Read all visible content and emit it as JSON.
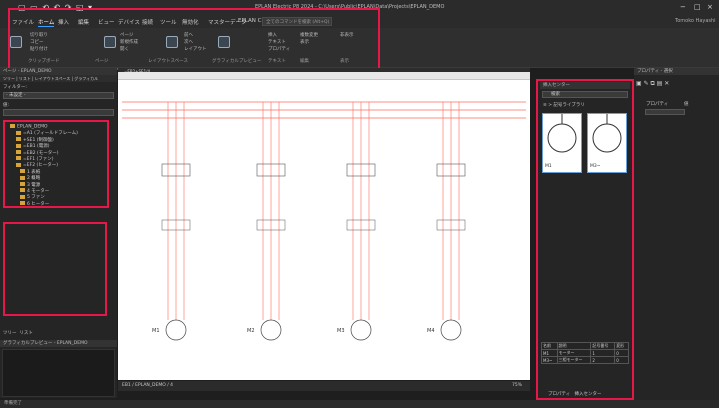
{
  "window": {
    "title": "EPLAN Electric P8 2024 - C:\\Users\\Public\\EPLAN\\Data\\Projects\\EPLAN_DEMO",
    "min": "−",
    "max": "□",
    "close": "×"
  },
  "menu": [
    "ファイル",
    "ホーム",
    "挿入",
    "編集",
    "ビュー",
    "デバイス",
    "接続",
    "ツール",
    "無効化",
    "マスターデータ",
    "EPLAN Cloud"
  ],
  "menu_active": 1,
  "search_placeholder": "全てのコマンドを検索 (Alt+Q)",
  "user": "Tomoko Hayashi",
  "ribbon": {
    "groups": [
      "クリップボード",
      "ページ",
      "レイアウトスペース",
      "グラフィカルプレビュー",
      "テキスト",
      "編集",
      "表示"
    ],
    "items": [
      "切り取り",
      "コピー",
      "貼り付け",
      "ページ",
      "新規作成",
      "開く",
      "前へ",
      "次へ",
      "レイアウト",
      "挿入",
      "テキスト",
      "プロパティ",
      "複数変更",
      "表示",
      "非表示"
    ]
  },
  "left_panel": {
    "title": "ページ - EPLAN_DEMO",
    "tabs": [
      "ツリー",
      "リスト",
      "レイアウトスペース",
      "グラフィカル"
    ],
    "filter_label": "フィルター:",
    "filter_value": "- 未設定 -",
    "value_label": "値:",
    "tree": [
      "EPLAN_DEMO",
      "=A1 (フィールドフレーム)",
      "+SE1 (制御盤)",
      "=EB1 (電源)",
      "=EB2 (モーター)",
      "=EF1 (ファン)",
      "=EF2 (ヒーター)",
      "1 表紙",
      "2 概略",
      "3 電源",
      "4 モーター",
      "5 ファン",
      "6 ヒーター"
    ],
    "bottom_tabs": [
      "ツリー",
      "リスト"
    ],
    "preview_title": "グラフィカルプレビュー - EPLAN_DEMO"
  },
  "doc_tab": "=EB2+SE1/4",
  "motors": [
    "M1",
    "M2",
    "M3",
    "M4"
  ],
  "right_panel": {
    "title": "挿入センター",
    "search_placeholder": "検索",
    "crumb": "≡ > 記号ライブラリ",
    "thumbs": [
      "M1",
      "M3~"
    ],
    "table_headers": [
      "名前",
      "説明",
      "記号番号",
      "変形"
    ],
    "table_rows": [
      [
        "M1",
        "モーター",
        "1",
        "0"
      ],
      [
        "M3~",
        "三相モーター",
        "2",
        "0"
      ]
    ],
    "bottom_tabs": [
      "プロパティ",
      "挿入センター"
    ]
  },
  "far_right": {
    "title": "プロパティ - 選択",
    "col1": "プロパティ",
    "col2": "値"
  },
  "canvas_status": "EB1 / EPLAN_DEMO / 4",
  "zoom": "75%",
  "statusbar": "準備完了",
  "colors": {
    "highlight": "#e8174a",
    "wire": "#ff6a5c"
  }
}
